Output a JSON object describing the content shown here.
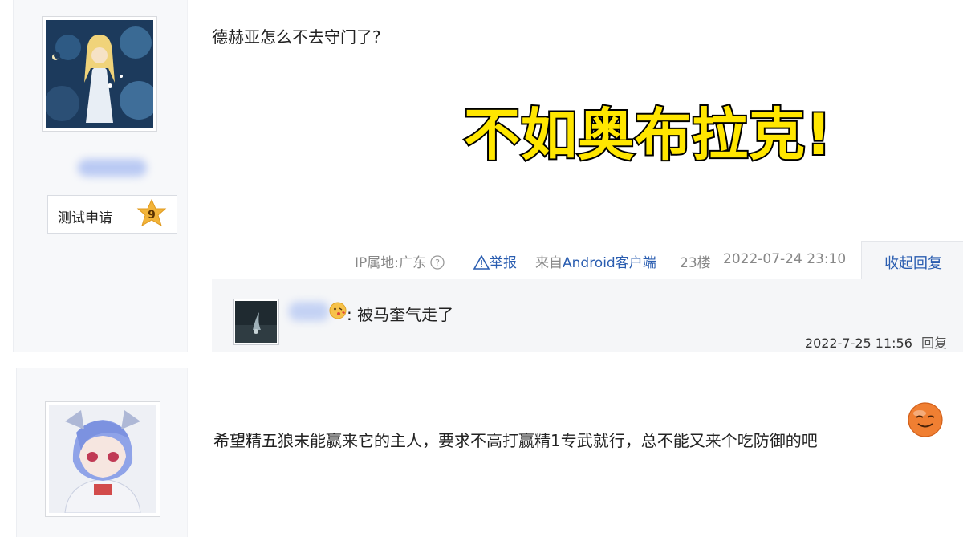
{
  "post1": {
    "text": "德赫亚怎么不去守门了?",
    "caption": "不如奥布拉克!",
    "badge": {
      "label": "测试申请",
      "level": "9"
    },
    "meta": {
      "ip": "IP属地:广东",
      "report": "举报",
      "from_prefix": "来自",
      "client": "Android客户端",
      "floor": "23楼",
      "time": "2022-07-24 23:10",
      "collapse": "收起回复"
    },
    "reply": {
      "text": ": 被马奎气走了",
      "time": "2022-7-25 11:56",
      "reply_label": "回复"
    }
  },
  "post2": {
    "text": "希望精五狼末能赢来它的主人，要求不高打赢精1专武就行，总不能又来个吃防御的吧"
  },
  "colors": {
    "link": "#2a5db0",
    "caption_fill": "#ffe600",
    "caption_stroke": "#000000",
    "meta": "#888888"
  },
  "icons": [
    "help-circle-icon",
    "warning-triangle-icon",
    "level-star-icon",
    "kiss-emoji-icon",
    "laugh-emoji-icon"
  ]
}
